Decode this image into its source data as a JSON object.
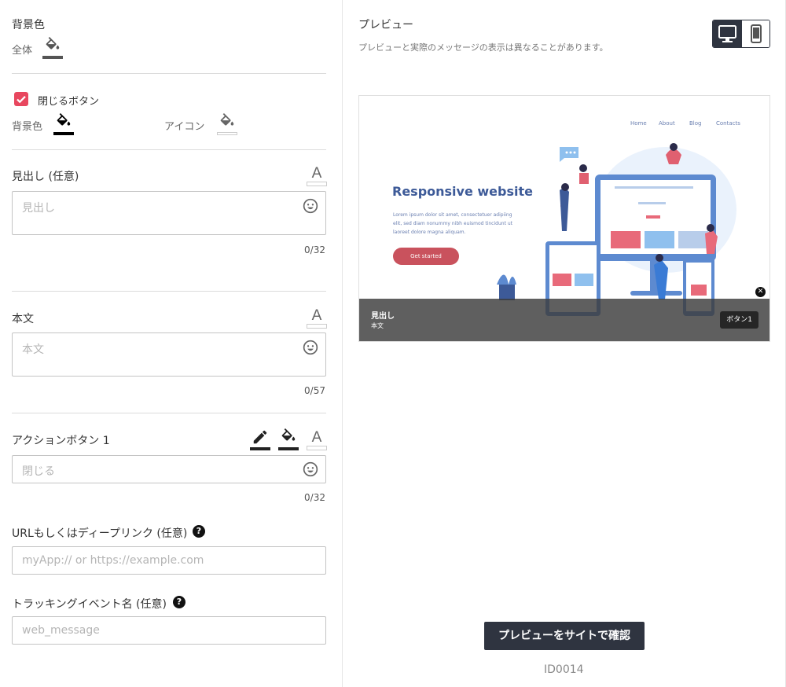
{
  "background": {
    "title": "背景色",
    "all_label": "全体",
    "bucket_color": "#555555"
  },
  "close_button": {
    "label": "閉じるボタン",
    "checked": true,
    "bg_label": "背景色",
    "icon_label": "アイコン",
    "bg_color": "#000000",
    "icon_color": "#ffffff"
  },
  "headline": {
    "title": "見出し (任意)",
    "placeholder": "見出し",
    "counter": "0/32"
  },
  "body": {
    "title": "本文",
    "placeholder": "本文",
    "counter": "0/57"
  },
  "action_button": {
    "title": "アクションボタン 1",
    "placeholder": "閉じる",
    "counter": "0/32"
  },
  "url": {
    "title": "URLもしくはディープリンク (任意)",
    "placeholder": "myApp:// or https://example.com",
    "help": "?"
  },
  "tracking": {
    "title": "トラッキングイベント名 (任意)",
    "placeholder": "web_message",
    "help": "?"
  },
  "preview": {
    "title": "プレビュー",
    "note": "プレビューと実際のメッセージの表示は異なることがあります。",
    "device_selected": "desktop",
    "site": {
      "nav": [
        "Home",
        "About",
        "Blog",
        "Contacts"
      ],
      "hero_title": "Responsive website",
      "hero_text": [
        "Lorem ipsum dolor sit amet, consectetuer adipiing",
        "elit, sed diam nonummy nibh euismod tincidunt ut",
        "laoreet dolore magna aliquam."
      ],
      "cta": "Get started"
    },
    "banner": {
      "headline": "見出し",
      "body": "本文",
      "button": "ボタン1",
      "close": "✕"
    },
    "confirm_label": "プレビューをサイトで確認",
    "id": "ID0014"
  },
  "colors": {
    "accent": "#e8475f",
    "dark": "#2f3440",
    "brand_blue": "#3d5a98"
  }
}
